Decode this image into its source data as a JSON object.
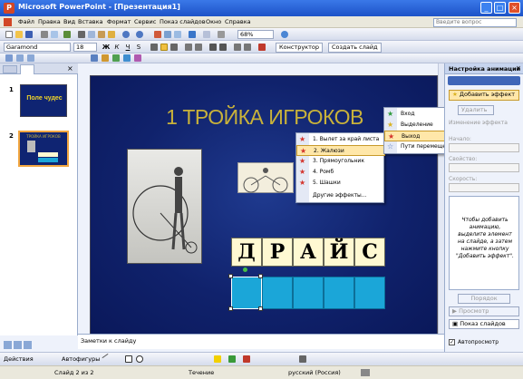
{
  "window": {
    "title": "Microsoft PowerPoint - [Презентация1]"
  },
  "menu": {
    "items": [
      "Файл",
      "Правка",
      "Вид",
      "Вставка",
      "Формат",
      "Сервис",
      "Показ слайдов",
      "Окно",
      "Справка"
    ],
    "ask_placeholder": "Введите вопрос"
  },
  "toolbar": {
    "zoom": "68%",
    "font": "Garamond",
    "size": "18",
    "design_label": "Конструктор",
    "new_slide_label": "Создать слайд"
  },
  "thumbnails": [
    {
      "num": "1",
      "title": "Поле чудес"
    },
    {
      "num": "2",
      "title": "ТРОЙКА ИГРОКОВ"
    }
  ],
  "slide": {
    "title": "1 ТРОЙКА ИГРОКОВ",
    "letters": [
      "Д",
      "Р",
      "А",
      "Й",
      "С"
    ]
  },
  "context_menu": {
    "items": [
      "1. Вылет за край листа",
      "2. Жалюзи",
      "3. Прямоугольник",
      "4. Ромб",
      "5. Шашки",
      "Другие эффекты..."
    ]
  },
  "submenu": {
    "items": [
      "Вход",
      "Выделение",
      "Выход",
      "Пути перемещения"
    ]
  },
  "task_pane": {
    "title": "Настройка анимации",
    "add_effect": "Добавить эффект",
    "remove": "Удалить",
    "change_label": "Изменение эффекта",
    "start_label": "Начало:",
    "property_label": "Свойство:",
    "speed_label": "Скорость:",
    "hint": "Чтобы добавить анимацию, выделите элемент на слайде, а затем нажмите кнопку \"Добавить эффект\".",
    "reorder": "Порядок",
    "play": "Просмотр",
    "slideshow": "Показ слайдов",
    "autopreview": "Автопросмотр"
  },
  "notes": {
    "placeholder": "Заметки к слайду"
  },
  "drawbar": {
    "actions": "Действия",
    "autoshapes": "Автофигуры"
  },
  "status": {
    "slide": "Слайд 2 из 2",
    "design": "Течение",
    "language": "русский (Россия)"
  }
}
